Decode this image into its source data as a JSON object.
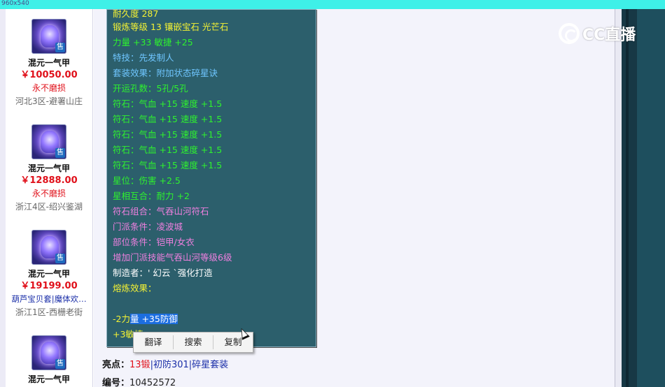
{
  "window": {
    "title": "960x540"
  },
  "listing": [
    {
      "name": "混元一气甲",
      "price": "￥10050.00",
      "note": "永不磨损",
      "server": "河北3区-避署山庄",
      "badge": "售"
    },
    {
      "name": "混元一气甲",
      "price": "￥12888.00",
      "note": "永不磨损",
      "server": "浙江4区-绍兴鉴湖",
      "badge": "售"
    },
    {
      "name": "混元一气甲",
      "price": "￥19199.00",
      "note": "葫芦宝贝套|魔体欢…",
      "server": "浙江1区-西栅老街",
      "badge": "售"
    },
    {
      "name": "混元一气甲",
      "price": "",
      "note": "",
      "server": "",
      "badge": "售"
    }
  ],
  "tooltip": {
    "lines": [
      {
        "text": "耐久度 287",
        "color": "yellow"
      },
      {
        "text": "锻炼等级 13 镶嵌宝石 光芒石",
        "color": "yellow"
      },
      {
        "text": "力量 +33 敏捷 +25",
        "color": "green"
      },
      {
        "text": "特技：先发制人",
        "color": "blue"
      },
      {
        "text": "套装效果：附加状态碎星诀",
        "color": "blue"
      },
      {
        "text": "开运孔数：5孔/5孔",
        "color": "green"
      },
      {
        "text": "符石：气血 +15 速度 +1.5",
        "color": "green"
      },
      {
        "text": "符石：气血 +15 速度 +1.5",
        "color": "green"
      },
      {
        "text": "符石：气血 +15 速度 +1.5",
        "color": "green"
      },
      {
        "text": "符石：气血 +15 速度 +1.5",
        "color": "green"
      },
      {
        "text": "符石：气血 +15 速度 +1.5",
        "color": "green"
      },
      {
        "text": "星位：伤害 +2.5",
        "color": "green"
      },
      {
        "text": "星相互合：耐力 +2",
        "color": "green"
      },
      {
        "text": "符石组合：气吞山河符石",
        "color": "pink"
      },
      {
        "text": "门派条件：凌波城",
        "color": "pink"
      },
      {
        "text": "部位条件：铠甲/女衣",
        "color": "pink"
      },
      {
        "text": "增加门派技能气吞山河等级6级",
        "color": "pink"
      },
      {
        "text": "制造者：' 幻云 `强化打造",
        "color": "white"
      },
      {
        "text": "熔炼效果：",
        "color": "yellow"
      }
    ],
    "melt_prefix": "-2力",
    "melt_selected": "量 +35防御",
    "melt_second": "+3敏捷"
  },
  "context_menu": {
    "items": [
      "翻译",
      "搜索",
      "复制"
    ]
  },
  "details": {
    "highlight_label": "亮点：",
    "highlight_red": "13锻",
    "highlight_sep1": "|",
    "highlight_mid": "初防301",
    "highlight_sep2": "|",
    "highlight_end": "碎星套装",
    "id_label": "编号：",
    "id_value": "10452572"
  },
  "watermark": {
    "text": "CC直播"
  }
}
